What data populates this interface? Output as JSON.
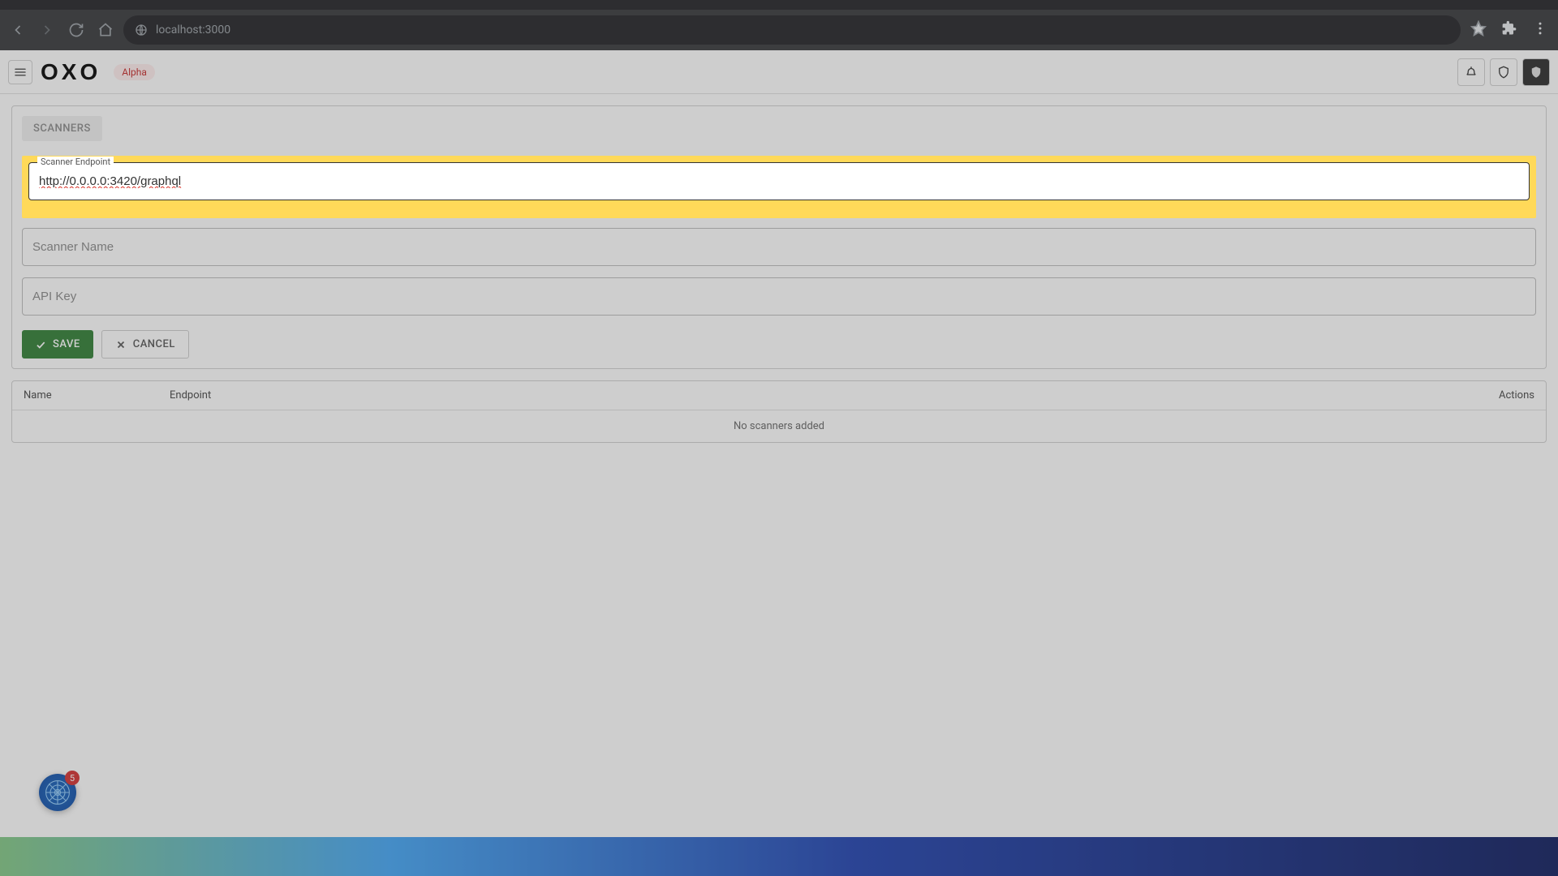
{
  "browser": {
    "url": "localhost:3000"
  },
  "header": {
    "logo": "OXO",
    "badge": "Alpha"
  },
  "page": {
    "scanners_btn": "SCANNERS",
    "fields": {
      "endpoint_label": "Scanner Endpoint",
      "endpoint_value": "http://0.0.0.0:3420/graphql",
      "name_placeholder": "Scanner Name",
      "apikey_placeholder": "API Key"
    },
    "buttons": {
      "save": "SAVE",
      "cancel": "CANCEL"
    },
    "table": {
      "col_name": "Name",
      "col_endpoint": "Endpoint",
      "col_actions": "Actions",
      "empty": "No scanners added"
    }
  },
  "float_badge": {
    "count": "5"
  }
}
